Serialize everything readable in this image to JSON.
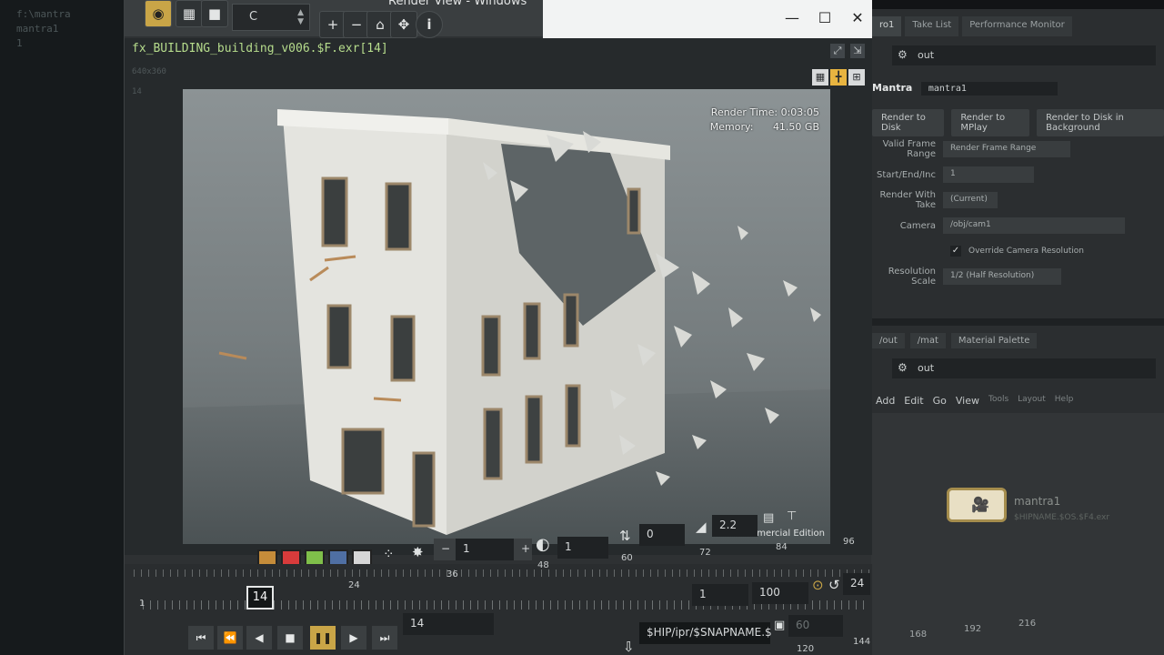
{
  "window": {
    "title": "Render View - Windows"
  },
  "background": {
    "left_text": [
      "f:\\mantra",
      "mantra1",
      "",
      "1"
    ]
  },
  "toolbar": {
    "channel": "C",
    "zoom_in": "+",
    "zoom_out": "−",
    "home": "⌂",
    "fit": "✥",
    "info": "i"
  },
  "viewport": {
    "file": "fx_BUILDING_building_v006.$F.exr[14]",
    "file_meta": [
      "640x360",
      "",
      "14"
    ],
    "render_time_label": "Render Time:",
    "render_time": "0:03:05",
    "memory_label": "Memory:",
    "memory": "41.50 GB",
    "watermark": "Non-Commercial Edition"
  },
  "controls": {
    "exposure_value": "1",
    "gamma_value": "1",
    "offset_value": "0",
    "gamma2_value": "2.2"
  },
  "timeline": {
    "ticks_top": [
      "60",
      "72",
      "84",
      "96"
    ],
    "ticks_bottom": [
      "1",
      "24",
      "36",
      "48"
    ],
    "current_frame": "14",
    "frame_field": "14",
    "range_start": "1",
    "range_end": "100",
    "fps": "24",
    "snapshot_path": "$HIP/ipr/$SNAPNAME.$",
    "snapshot_frame": "60",
    "lower_ticks": [
      "120",
      "144",
      "168",
      "192",
      "216"
    ]
  },
  "right_panel": {
    "tabs": [
      "ro1",
      "Take List",
      "Performance Monitor"
    ],
    "path": "out",
    "node_type": "Mantra",
    "node_name": "mantra1",
    "buttons": [
      "Render to Disk",
      "Render to MPlay",
      "Render to Disk in Background"
    ],
    "params": [
      {
        "label": "Valid Frame Range",
        "value": "Render Frame Range"
      },
      {
        "label": "Start/End/Inc",
        "value": "1"
      },
      {
        "label": "Render With Take",
        "value": "(Current)"
      },
      {
        "label": "Camera",
        "value": "/obj/cam1"
      },
      {
        "label": "",
        "value": "Override Camera Resolution"
      },
      {
        "label": "Resolution Scale",
        "value": "1/2 (Half Resolution)"
      }
    ],
    "net_tabs": [
      "/out",
      "/mat",
      "Material Palette"
    ],
    "net_path": "out",
    "menu": [
      "Add",
      "Edit",
      "Go",
      "View",
      "Tools",
      "Layout",
      "Help"
    ],
    "node_label": "mantra1",
    "node_sub": "$HIPNAME.$OS.$F4.exr"
  }
}
